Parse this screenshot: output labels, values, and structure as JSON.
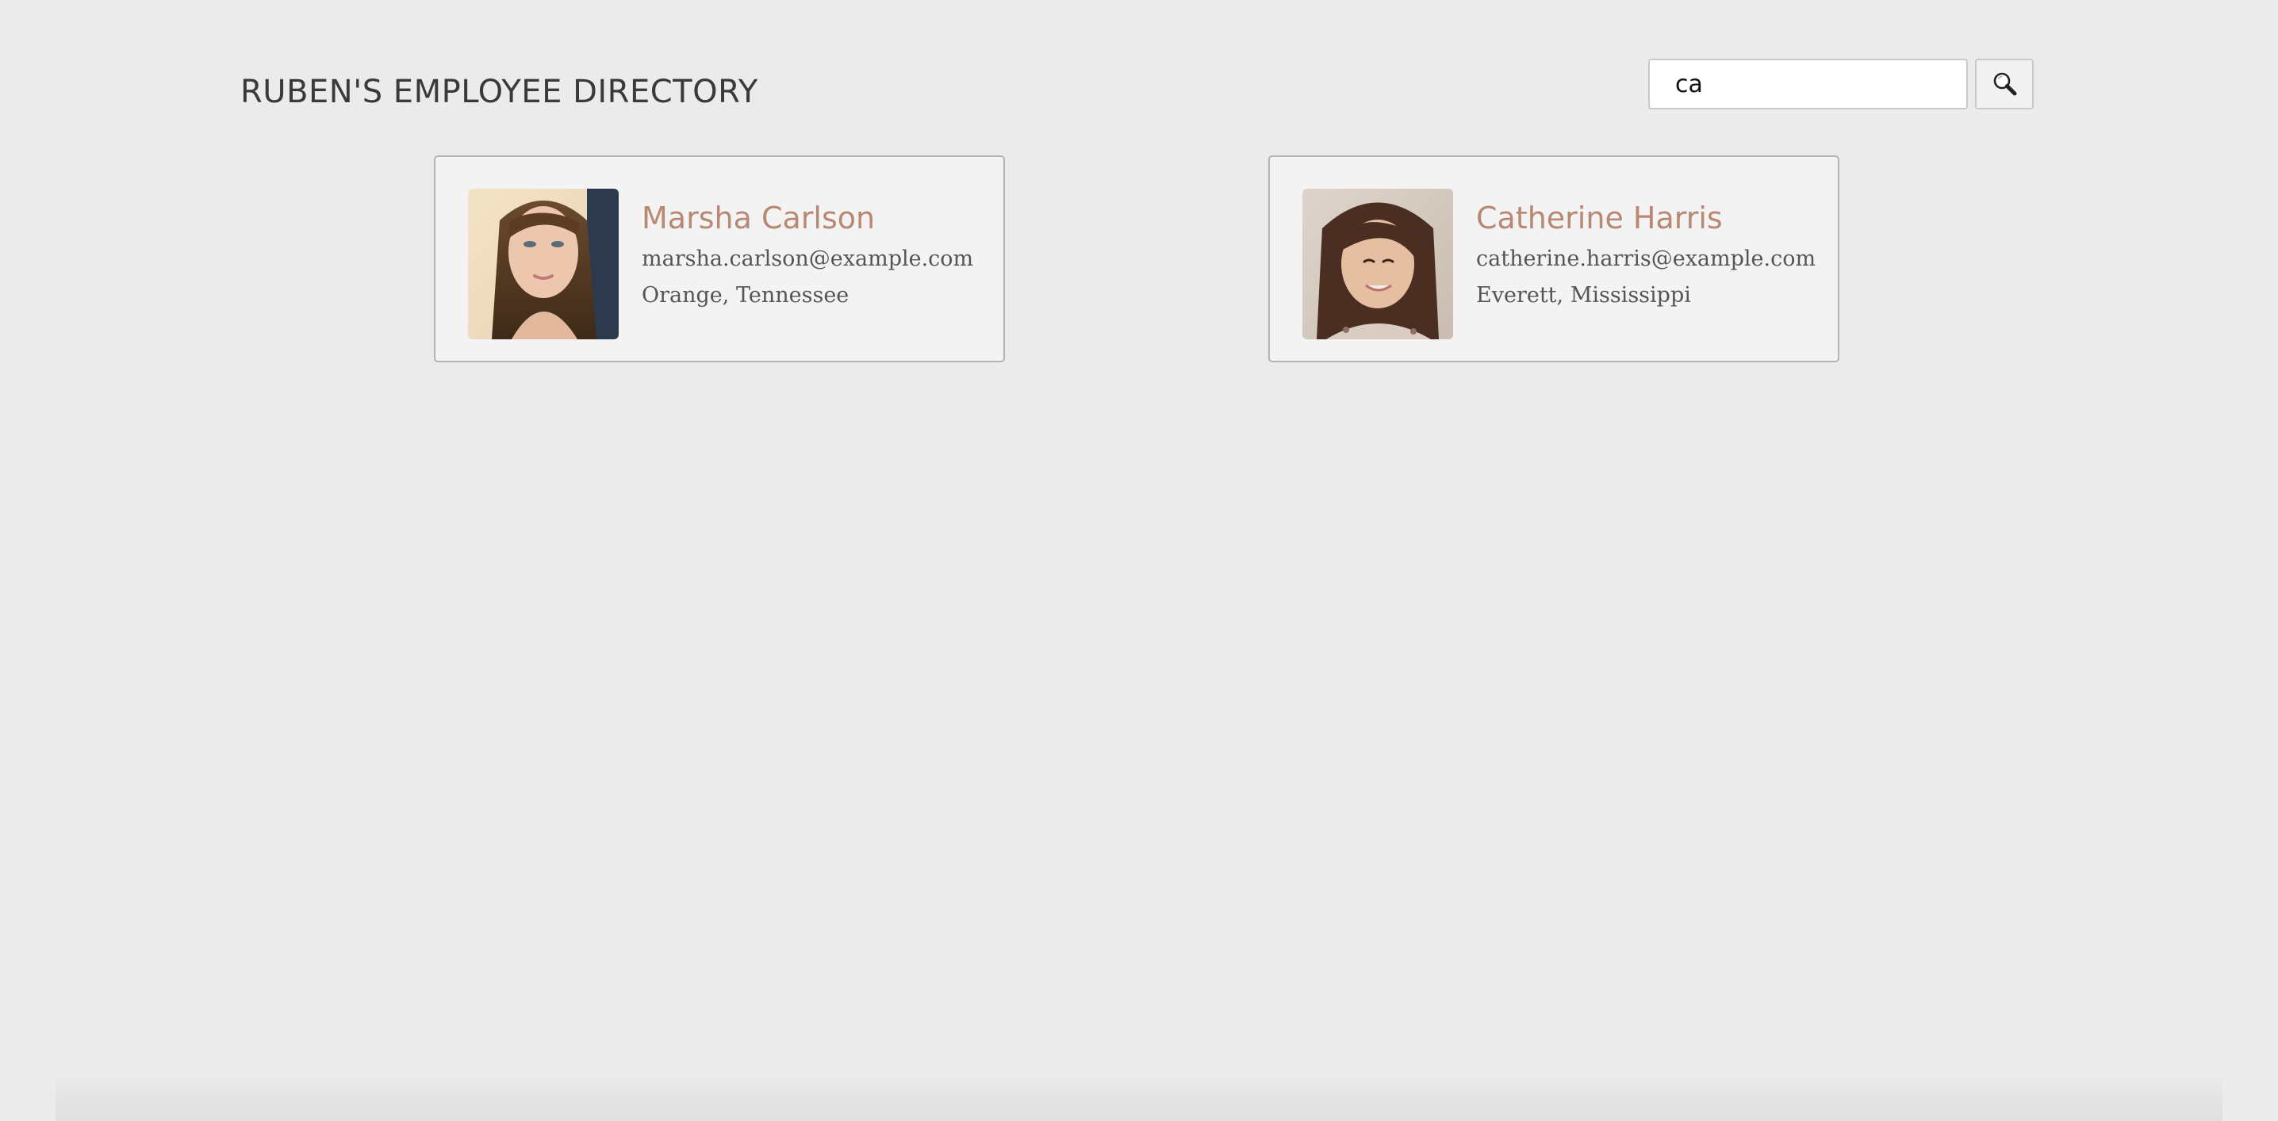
{
  "header": {
    "title": "RUBEN'S EMPLOYEE DIRECTORY",
    "search": {
      "value": "ca",
      "button_icon": "search-icon"
    }
  },
  "employees": [
    {
      "name": "Marsha Carlson",
      "email": "marsha.carlson@example.com",
      "location": "Orange, Tennessee"
    },
    {
      "name": "Catherine Harris",
      "email": "catherine.harris@example.com",
      "location": "Everett, Mississippi"
    }
  ],
  "colors": {
    "background": "#ebebeb",
    "card_background": "#f3f3f3",
    "card_border": "#b4b4b4",
    "name_accent": "#b98872",
    "text": "#555555",
    "title": "#3a3a3a"
  }
}
